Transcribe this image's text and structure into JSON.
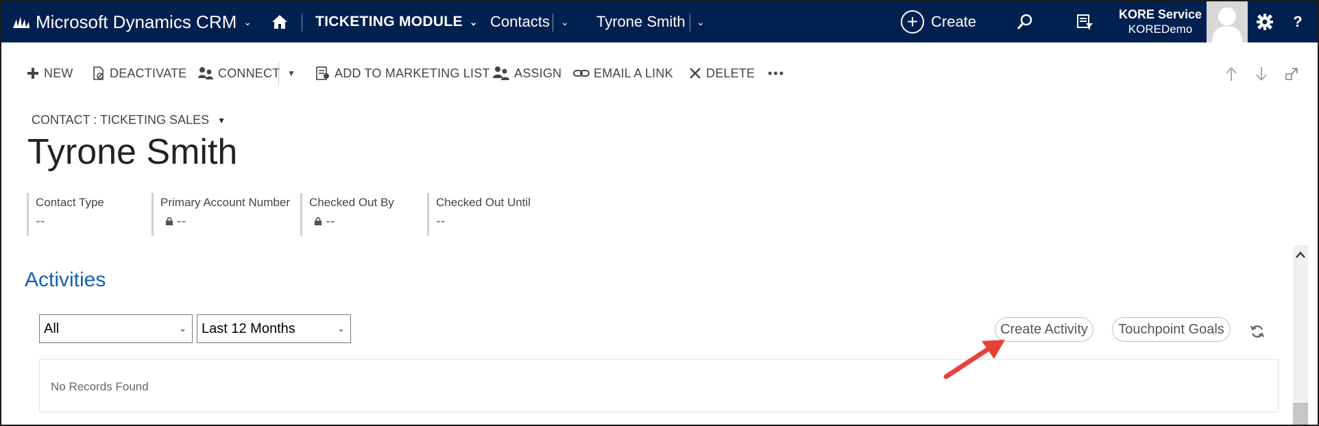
{
  "topnav": {
    "app_title": "Microsoft Dynamics CRM",
    "module": "TICKETING MODULE",
    "entity": "Contacts",
    "record": "Tyrone Smith",
    "create_label": "Create",
    "user_name": "KORE Service",
    "user_org": "KOREDemo",
    "help": "?"
  },
  "commands": {
    "new": "NEW",
    "deactivate": "DEACTIVATE",
    "connect": "CONNECT",
    "add_to_marketing_list": "ADD TO MARKETING LIST",
    "assign": "ASSIGN",
    "email_a_link": "EMAIL A LINK",
    "delete": "DELETE",
    "more": "•••"
  },
  "header": {
    "form_selector": "CONTACT : TICKETING SALES",
    "title": "Tyrone Smith",
    "fields": [
      {
        "label": "Contact Type",
        "value": "--"
      },
      {
        "label": "Primary Account Number",
        "value": "--"
      },
      {
        "label": "Checked Out By",
        "value": "--"
      },
      {
        "label": "Checked Out Until",
        "value": "--"
      }
    ]
  },
  "activities": {
    "title": "Activities",
    "filter_type": "All",
    "filter_period": "Last 12 Months",
    "create_activity": "Create Activity",
    "touchpoint_goals": "Touchpoint Goals",
    "empty_text": "No Records Found"
  },
  "colors": {
    "nav_bg": "#002050",
    "section_title": "#1060b0",
    "annotation_arrow": "#e8413a"
  }
}
